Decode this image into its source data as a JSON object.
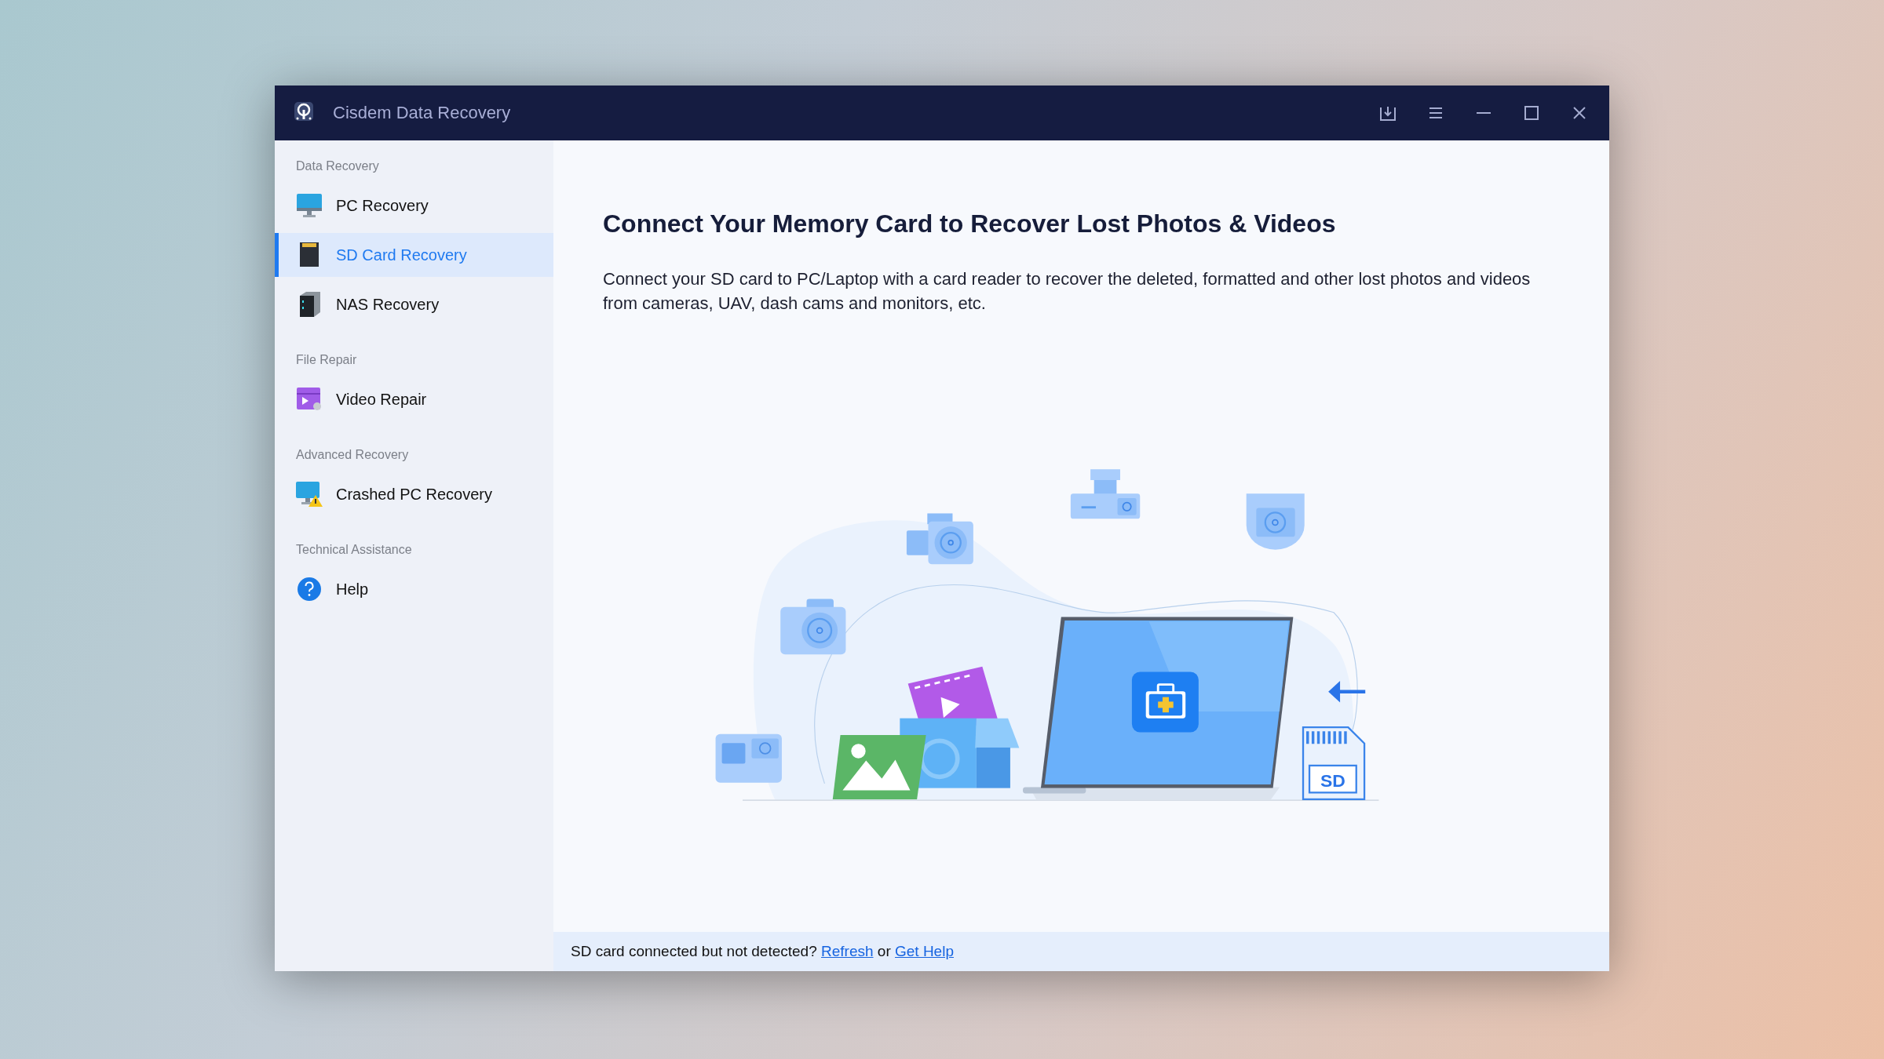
{
  "window": {
    "title": "Cisdem Data Recovery"
  },
  "sidebar": {
    "sections": [
      {
        "label": "Data Recovery",
        "items": [
          {
            "label": "PC Recovery",
            "selected": false
          },
          {
            "label": "SD Card Recovery",
            "selected": true
          },
          {
            "label": "NAS Recovery",
            "selected": false
          }
        ]
      },
      {
        "label": "File Repair",
        "items": [
          {
            "label": "Video Repair",
            "selected": false
          }
        ]
      },
      {
        "label": "Advanced Recovery",
        "items": [
          {
            "label": "Crashed PC Recovery",
            "selected": false
          }
        ]
      },
      {
        "label": "Technical Assistance",
        "items": [
          {
            "label": "Help",
            "selected": false
          }
        ]
      }
    ]
  },
  "main": {
    "heading": "Connect Your Memory Card to Recover Lost Photos & Videos",
    "description": "Connect your SD card to PC/Laptop with a card reader to recover the deleted, formatted and other lost photos and videos from cameras, UAV, dash cams and monitors, etc.",
    "illustration": {
      "sd_label": "SD"
    }
  },
  "footer": {
    "message": "SD card connected but not detected?",
    "refresh_link": "Refresh",
    "conjunction": "or",
    "help_link": "Get Help"
  }
}
